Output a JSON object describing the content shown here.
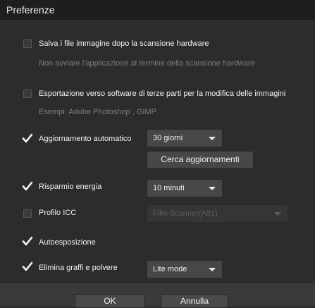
{
  "window": {
    "title": "Preferenze"
  },
  "options": {
    "save_images": {
      "label": "Salva i file immagine dopo la scansione hardware",
      "sub": "Non avviare l'applicazione al termine della scansione hardware",
      "checked": false
    },
    "export_third_party": {
      "label": "Esportazione verso software di terze parti per la modifica delle immagini",
      "sub": "Esempi: Adobe Photoshop , GIMP",
      "checked": false
    },
    "auto_update": {
      "label": "Aggiornamento automatico",
      "checked": true,
      "selected": "30 giorni",
      "button": "Cerca aggiornamenti"
    },
    "power_saving": {
      "label": "Risparmio energia",
      "checked": true,
      "selected": "10 minuti"
    },
    "icc_profile": {
      "label": "Profilo ICC",
      "checked": false,
      "selected": "Film Scanner(A81)"
    },
    "auto_exposure": {
      "label": "Autoesposizione",
      "checked": true
    },
    "dust_removal": {
      "label": "Elimina graffi e polvere",
      "checked": true,
      "selected": "Lite mode"
    }
  },
  "footer": {
    "ok": "OK",
    "cancel": "Annulla"
  },
  "colors": {
    "background": "#2c2c2c",
    "titlebar": "#1e1e1e",
    "control": "#474747",
    "text": "#f0f0f0",
    "muted": "#7d7d7d"
  },
  "icons": {
    "checked": "checkmark-icon",
    "dropdown": "chevron-down-icon"
  }
}
